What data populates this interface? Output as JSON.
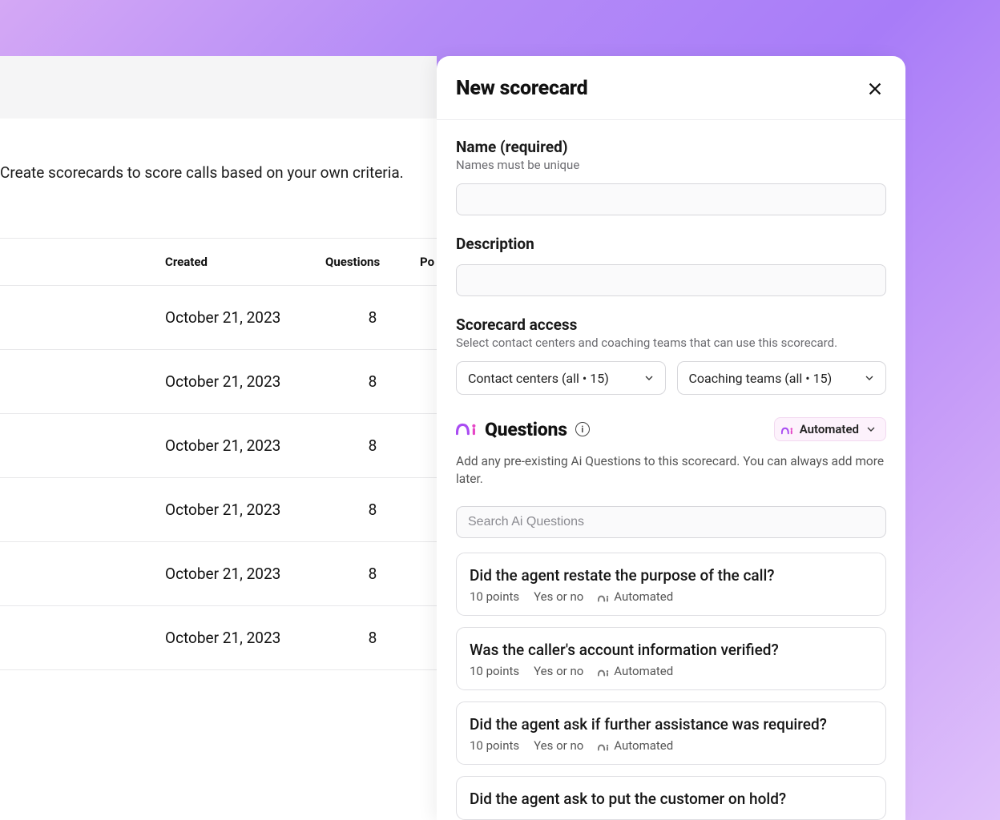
{
  "background": {
    "description": "Create scorecards to score calls based on your own criteria.",
    "columns": {
      "created": "Created",
      "questions": "Questions",
      "points_truncated": "Po"
    },
    "rows": [
      {
        "created": "October 21, 2023",
        "questions": "8"
      },
      {
        "created": "October 21, 2023",
        "questions": "8"
      },
      {
        "created": "October 21, 2023",
        "questions": "8"
      },
      {
        "created": "October 21, 2023",
        "questions": "8"
      },
      {
        "created": "October 21, 2023",
        "questions": "8"
      },
      {
        "created": "October 21, 2023",
        "questions": "8"
      }
    ]
  },
  "panel": {
    "title": "New scorecard",
    "name": {
      "label": "Name (required)",
      "help": "Names must be unique",
      "value": ""
    },
    "description": {
      "label": "Description",
      "value": ""
    },
    "access": {
      "label": "Scorecard access",
      "help": "Select contact centers and coaching teams that can use this scorecard.",
      "contact_centers_label": "Contact centers (all • 15)",
      "coaching_teams_label": "Coaching teams (all • 15)"
    },
    "questions": {
      "title": "Questions",
      "automated_label": "Automated",
      "help": "Add any pre-existing Ai Questions to this scorecard. You can always add more later.",
      "search_placeholder": "Search Ai Questions",
      "items": [
        {
          "title": "Did the agent restate the purpose of the call?",
          "points": "10 points",
          "type": "Yes or no",
          "mode": "Automated"
        },
        {
          "title": "Was the caller's account information verified?",
          "points": "10 points",
          "type": "Yes or no",
          "mode": "Automated"
        },
        {
          "title": "Did the agent ask if further assistance was required?",
          "points": "10 points",
          "type": "Yes or no",
          "mode": "Automated"
        },
        {
          "title": "Did the agent ask to put the customer on hold?",
          "points": "",
          "type": "",
          "mode": ""
        }
      ]
    }
  },
  "colors": {
    "accent_purple": "#a94cf2",
    "accent_pink": "#e546c6",
    "pill_bg": "#fdf2fc",
    "pill_border": "#f2d9f0"
  }
}
